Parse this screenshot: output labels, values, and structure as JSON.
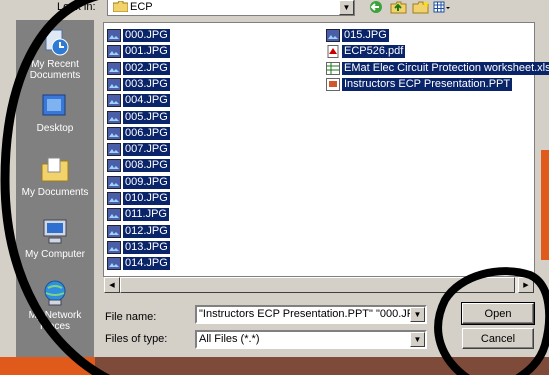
{
  "look_in": {
    "label": "Look in:",
    "value": "ECP"
  },
  "places": [
    {
      "label": "My Recent Documents",
      "icon": "recent-documents-icon"
    },
    {
      "label": "Desktop",
      "icon": "desktop-icon"
    },
    {
      "label": "My Documents",
      "icon": "my-documents-icon"
    },
    {
      "label": "My Computer",
      "icon": "my-computer-icon"
    },
    {
      "label": "My Network Places",
      "icon": "network-places-icon"
    }
  ],
  "files_col1": [
    "000.JPG",
    "001.JPG",
    "002.JPG",
    "003.JPG",
    "004.JPG",
    "005.JPG",
    "006.JPG",
    "007.JPG",
    "008.JPG",
    "009.JPG",
    "010.JPG",
    "011.JPG",
    "012.JPG",
    "013.JPG",
    "014.JPG"
  ],
  "files_col2": [
    "015.JPG",
    "ECP526.pdf",
    "EMat Elec Circuit Protection worksheet.xls",
    "Instructors ECP Presentation.PPT"
  ],
  "file_name": {
    "label": "File name:",
    "value": "\"Instructors ECP Presentation.PPT\" \"000.JPG\" \""
  },
  "file_type": {
    "label": "Files of type:",
    "value": "All Files (*.*)"
  },
  "buttons": {
    "open": "Open",
    "cancel": "Cancel"
  },
  "colors": {
    "selection": "#0a246a",
    "dialog": "#d4d0c8",
    "places_bar": "#808080"
  }
}
